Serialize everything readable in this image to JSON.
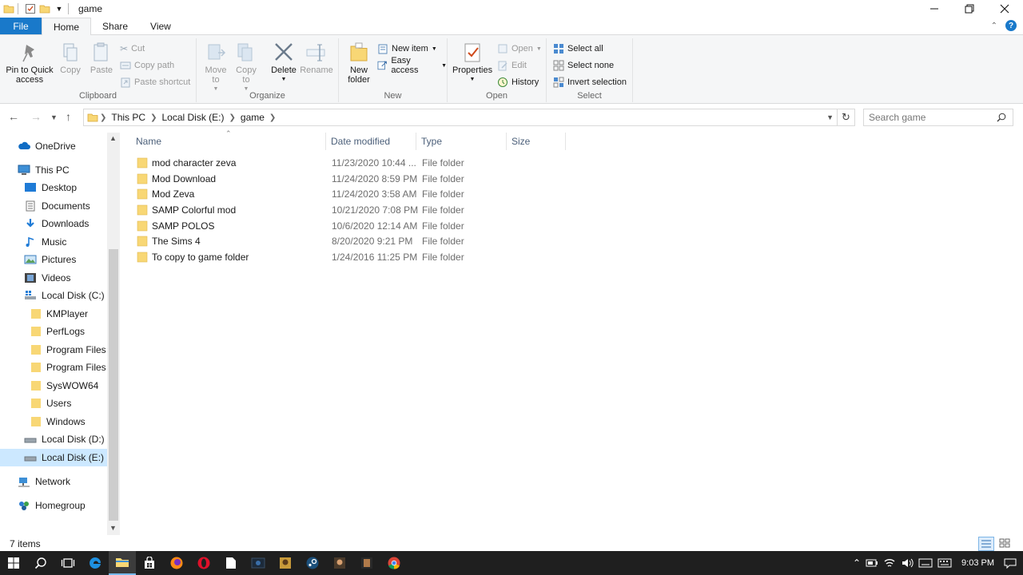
{
  "window": {
    "title": "game"
  },
  "tabs": {
    "file": "File",
    "home": "Home",
    "share": "Share",
    "view": "View"
  },
  "ribbon": {
    "clipboard": {
      "pin": "Pin to Quick access",
      "copy": "Copy",
      "paste": "Paste",
      "cut": "Cut",
      "copy_path": "Copy path",
      "paste_shortcut": "Paste shortcut",
      "label": "Clipboard"
    },
    "organize": {
      "move_to": "Move to",
      "copy_to": "Copy to",
      "delete": "Delete",
      "rename": "Rename",
      "label": "Organize"
    },
    "new": {
      "new_folder": "New folder",
      "new_item": "New item",
      "easy_access": "Easy access",
      "label": "New"
    },
    "open": {
      "properties": "Properties",
      "open": "Open",
      "edit": "Edit",
      "history": "History",
      "label": "Open"
    },
    "select": {
      "select_all": "Select all",
      "select_none": "Select none",
      "invert": "Invert selection",
      "label": "Select"
    }
  },
  "address": {
    "crumbs": [
      "This PC",
      "Local Disk (E:)",
      "game"
    ]
  },
  "search": {
    "placeholder": "Search game"
  },
  "nav": {
    "onedrive": "OneDrive",
    "thispc": "This PC",
    "desktop": "Desktop",
    "documents": "Documents",
    "downloads": "Downloads",
    "music": "Music",
    "pictures": "Pictures",
    "videos": "Videos",
    "diskc": "Local Disk (C:)",
    "kmplayer": "KMPlayer",
    "perflogs": "PerfLogs",
    "programfiles": "Program Files",
    "programfilesx86": "Program Files (x",
    "syswow64": "SysWOW64",
    "users": "Users",
    "windows": "Windows",
    "diskd": "Local Disk (D:)",
    "diske": "Local Disk (E:)",
    "network": "Network",
    "homegroup": "Homegroup"
  },
  "columns": {
    "name": "Name",
    "date": "Date modified",
    "type": "Type",
    "size": "Size"
  },
  "files": [
    {
      "name": "mod character zeva",
      "date": "11/23/2020 10:44 ...",
      "type": "File folder"
    },
    {
      "name": "Mod Download",
      "date": "11/24/2020 8:59 PM",
      "type": "File folder"
    },
    {
      "name": "Mod Zeva",
      "date": "11/24/2020 3:58 AM",
      "type": "File folder"
    },
    {
      "name": "SAMP Colorful mod",
      "date": "10/21/2020 7:08 PM",
      "type": "File folder"
    },
    {
      "name": "SAMP POLOS",
      "date": "10/6/2020 12:14 AM",
      "type": "File folder"
    },
    {
      "name": "The Sims 4",
      "date": "8/20/2020 9:21 PM",
      "type": "File folder"
    },
    {
      "name": "To copy to game folder",
      "date": "1/24/2016 11:25 PM",
      "type": "File folder"
    }
  ],
  "status": {
    "items": "7 items"
  },
  "taskbar": {
    "time": "9:03 PM"
  },
  "colors": {
    "accent": "#1979ca",
    "folder": "#f8d775",
    "selection": "#cce8ff"
  }
}
